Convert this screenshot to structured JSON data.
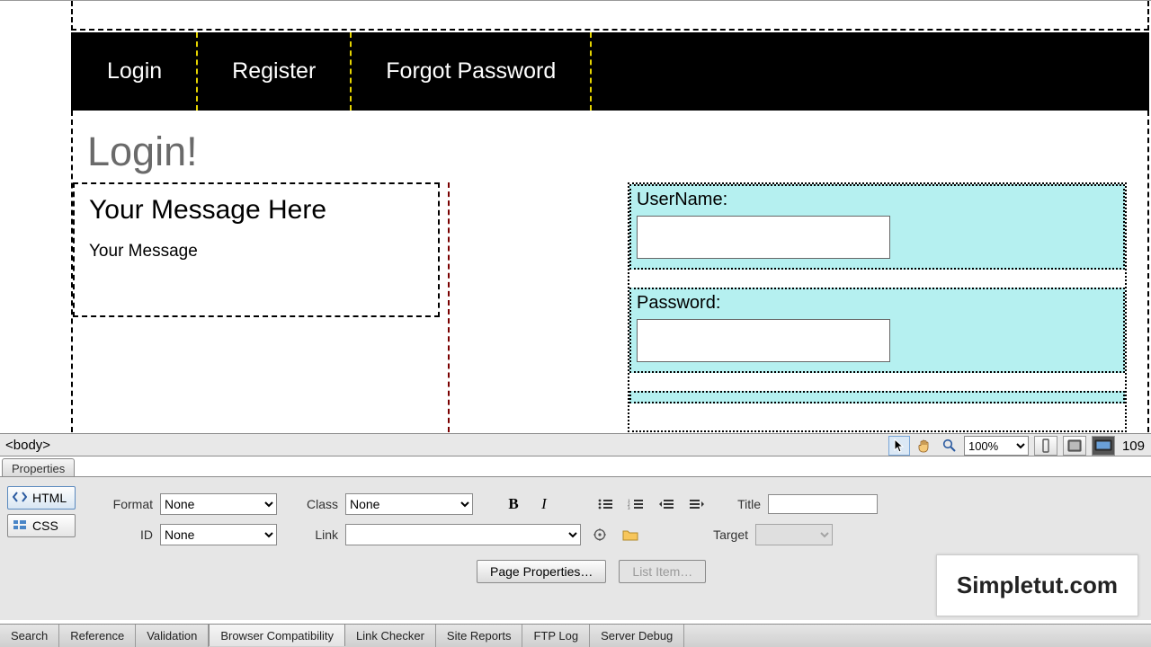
{
  "nav": {
    "items": [
      "Login",
      "Register",
      "Forgot Password"
    ]
  },
  "page": {
    "title": "Login!",
    "message_heading": "Your Message Here",
    "message_body": "Your Message",
    "username_label": "UserName:",
    "password_label": "Password:"
  },
  "tag_selector": "<body>",
  "zoom_value": "100%",
  "side_number": "109",
  "properties": {
    "tab": "Properties",
    "modes": {
      "html": "HTML",
      "css": "CSS"
    },
    "labels": {
      "format": "Format",
      "class": "Class",
      "id": "ID",
      "link": "Link",
      "title": "Title",
      "target": "Target"
    },
    "format_value": "None",
    "id_value": "None",
    "class_value": "None",
    "link_value": "",
    "title_value": "",
    "target_value": "",
    "page_props_btn": "Page Properties…",
    "list_item_btn": "List Item…"
  },
  "bottom_tabs": [
    "Search",
    "Reference",
    "Validation",
    "Browser Compatibility",
    "Link Checker",
    "Site Reports",
    "FTP Log",
    "Server Debug"
  ],
  "watermark": "Simpletut.com"
}
